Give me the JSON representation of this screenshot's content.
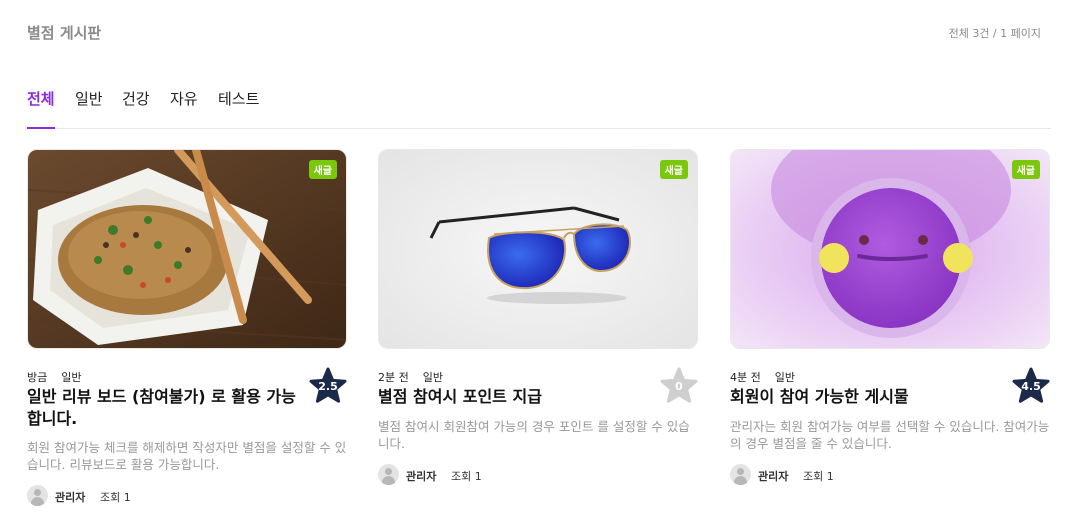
{
  "board": {
    "title": "별점 게시판",
    "page_info": "전체 3건 / 1 페이지"
  },
  "tabs": [
    {
      "label": "전체",
      "active": true
    },
    {
      "label": "일반",
      "active": false
    },
    {
      "label": "건강",
      "active": false
    },
    {
      "label": "자유",
      "active": false
    },
    {
      "label": "테스트",
      "active": false
    }
  ],
  "posts": [
    {
      "badge": "새글",
      "time": "방금",
      "category": "일반",
      "title": "일반 리뷰 보드 (참여불가) 로 활용 가능합니다.",
      "description": "회원 참여가능 체크를 해제하면 작성자만 별점을 설정할 수 있습니다. 리뷰보드로 활용 가능합니다.",
      "author": "관리자",
      "views": "조회 1",
      "rating": "2.5",
      "rating_color": "#1b2a4a",
      "image": "fried-rice-photo"
    },
    {
      "badge": "새글",
      "time": "2분 전",
      "category": "일반",
      "title": "별점 참여시 포인트 지급",
      "description": "별점 참여시 회원참여 가능의 경우 포인트 를 설정할 수 있습니다.",
      "author": "관리자",
      "views": "조회 1",
      "rating": "0",
      "rating_color": "#cfcfcf",
      "image": "sunglasses-photo"
    },
    {
      "badge": "새글",
      "time": "4분 전",
      "category": "일반",
      "title": "회원이 참여 가능한 게시물",
      "description": "관리자는 회원 참여가능 여부를 선택할 수 있습니다. 참여가능의 경우 별점을 줄 수 있습니다.",
      "author": "관리자",
      "views": "조회 1",
      "rating": "4.5",
      "rating_color": "#1b2a4a",
      "image": "purple-face-photo"
    }
  ]
}
